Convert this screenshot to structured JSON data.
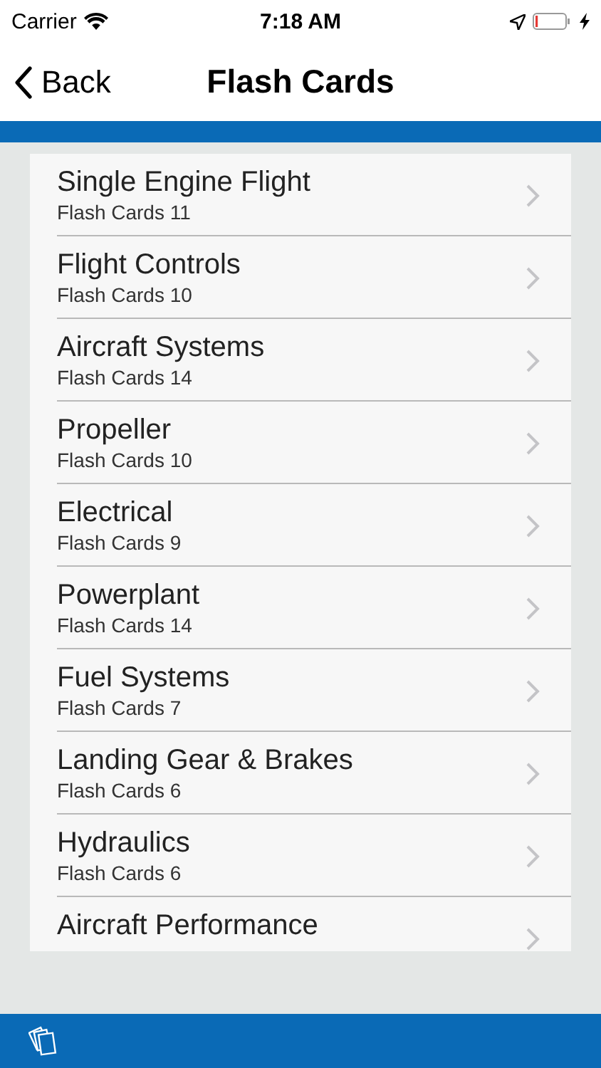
{
  "status_bar": {
    "carrier": "Carrier",
    "time": "7:18 AM"
  },
  "nav_bar": {
    "back": "Back",
    "title": "Flash Cards"
  },
  "items": [
    {
      "title": "Single Engine Flight",
      "subtitle": "Flash Cards 11"
    },
    {
      "title": "Flight Controls",
      "subtitle": "Flash Cards 10"
    },
    {
      "title": "Aircraft Systems",
      "subtitle": "Flash Cards 14"
    },
    {
      "title": "Propeller",
      "subtitle": "Flash Cards 10"
    },
    {
      "title": "Electrical",
      "subtitle": "Flash Cards 9"
    },
    {
      "title": "Powerplant",
      "subtitle": "Flash Cards 14"
    },
    {
      "title": "Fuel Systems",
      "subtitle": "Flash Cards 7"
    },
    {
      "title": "Landing Gear & Brakes",
      "subtitle": "Flash Cards 6"
    },
    {
      "title": "Hydraulics",
      "subtitle": "Flash Cards 6"
    },
    {
      "title": "Aircraft Performance"
    }
  ]
}
